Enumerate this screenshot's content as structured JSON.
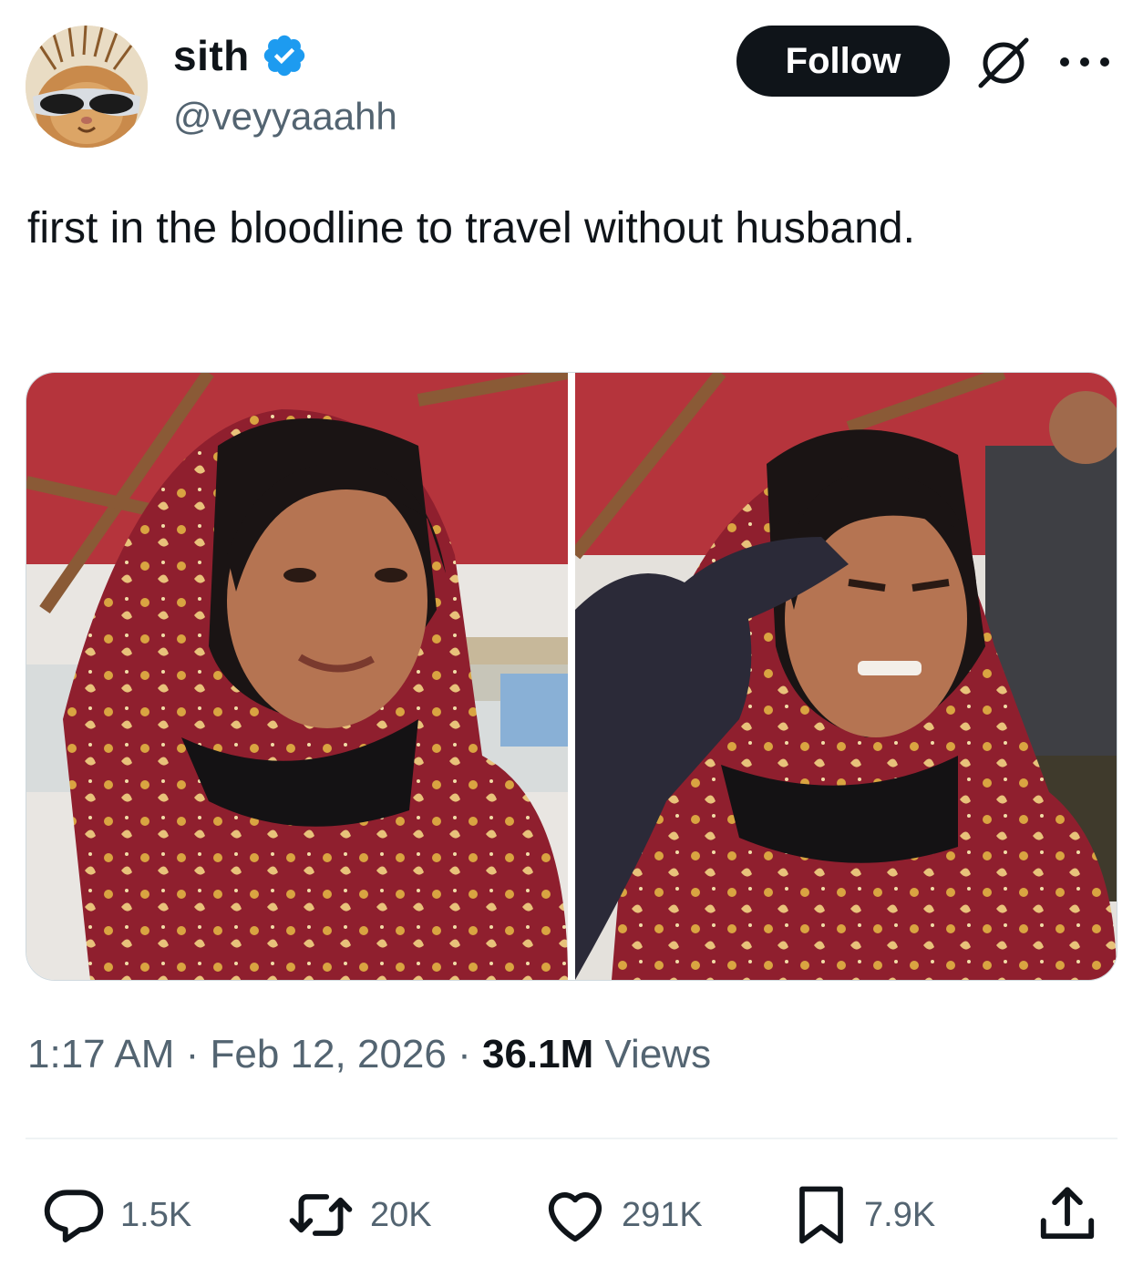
{
  "author": {
    "display_name": "sith",
    "handle": "@veyyaaahh",
    "verified": true
  },
  "follow_button": "Follow",
  "tweet": {
    "text": "first in the bloodline to travel without husband."
  },
  "meta": {
    "time": "1:17 AM",
    "sep1": " · ",
    "date": "Feb 12, 2026",
    "sep2": " · ",
    "views_count": "36.1M",
    "views_label": " Views"
  },
  "actions": {
    "replies": "1.5K",
    "reposts": "20K",
    "likes": "291K",
    "bookmarks": "7.9K"
  },
  "colors": {
    "text_primary": "#0f1419",
    "text_secondary": "#536471",
    "verified_blue": "#1d9bf0",
    "shawl_red": "#8f1f2e",
    "shawl_gold": "#d9a441"
  },
  "icons": [
    "verified-badge-icon",
    "grok-icon",
    "more-icon",
    "reply-icon",
    "repost-icon",
    "like-icon",
    "bookmark-icon",
    "share-icon"
  ]
}
